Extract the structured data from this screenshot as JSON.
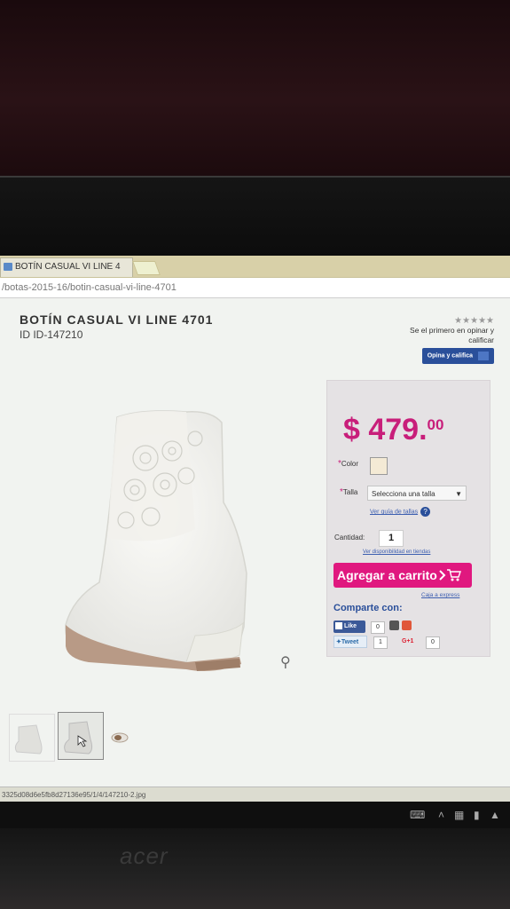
{
  "browser": {
    "tab_title": "BOTÍN CASUAL VI LINE 4",
    "url": "/botas-2015-16/botin-casual-vi-line-4701",
    "status_url": "3325d08d6e5fb8d27136e95/1/4/147210-2.jpg"
  },
  "product": {
    "title": "BOTÍN CASUAL VI LINE 4701",
    "id_text": "ID ID-147210"
  },
  "rating": {
    "stars": "★★★★★",
    "prompt": "Se el primero en opinar y calificar",
    "button_label": "Opina y califica"
  },
  "buybox": {
    "price_main": "$ 479.",
    "price_cents": "00",
    "color_label": "Color",
    "size_label": "Talla",
    "size_placeholder": "Selecciona una talla",
    "size_guide": "Ver guía de tallas",
    "qty_label": "Cantidad:",
    "qty_value": "1",
    "store_availability": "Ver disponibilidad en tiendas",
    "add_to_cart": "Agregar a carrito",
    "express_checkout": "Caja a express",
    "share_title": "Comparte con:",
    "fb_like": "Like",
    "fb_count": "0",
    "tweet_label": "Tweet",
    "tweet_count": "1",
    "gplus_label": "G+1",
    "gplus_count": "0"
  },
  "colors": {
    "price": "#c81e7a",
    "cart_button": "#e0187f",
    "link_blue": "#2a4f9a"
  },
  "laptop": {
    "brand": "acer"
  }
}
